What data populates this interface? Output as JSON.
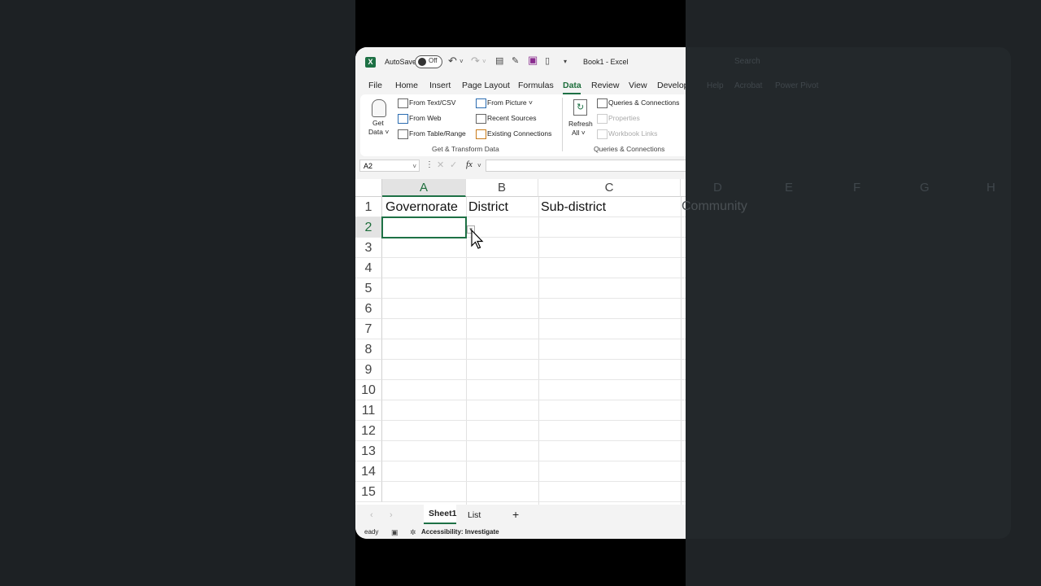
{
  "titlebar": {
    "autosave_label": "AutoSave",
    "autosave_state": "Off",
    "title": "Book1 - Excel"
  },
  "tabs": [
    "File",
    "Home",
    "Insert",
    "Page Layout",
    "Formulas",
    "Data",
    "Review",
    "View",
    "Develop"
  ],
  "active_tab": "Data",
  "ribbon": {
    "get_data": {
      "line1": "Get",
      "line2": "Data ˅"
    },
    "from_text_csv": "From Text/CSV",
    "from_web": "From Web",
    "from_table_range": "From Table/Range",
    "from_picture": "From Picture ˅",
    "recent_sources": "Recent Sources",
    "existing_connections": "Existing Connections",
    "group1_label": "Get & Transform Data",
    "refresh": {
      "line1": "Refresh",
      "line2": "All ˅"
    },
    "queries_connections": "Queries & Connections",
    "properties": "Properties",
    "workbook_links": "Workbook Links",
    "group2_label": "Queries & Connections"
  },
  "formula_bar": {
    "name_box": "A2",
    "fx": "fx",
    "value": ""
  },
  "grid": {
    "columns": [
      "A",
      "B",
      "C"
    ],
    "selected_column": "A",
    "rows": [
      "1",
      "2",
      "3",
      "4",
      "5",
      "6",
      "7",
      "8",
      "9",
      "10",
      "11",
      "12",
      "13",
      "14",
      "15"
    ],
    "selected_row": "2",
    "row1_values": [
      "Governorate",
      "District",
      "Sub-district"
    ],
    "active_cell": "A2"
  },
  "overlay": {
    "extra_columns": [
      "D",
      "E",
      "F",
      "G",
      "H"
    ],
    "overflow_header": "Community",
    "ribbon_tabs": [
      "Help",
      "Acrobat",
      "Power Pivot"
    ],
    "search_placeholder": "Search"
  },
  "sheets": {
    "tabs": [
      "Sheet1",
      "List"
    ],
    "active": "Sheet1",
    "add": "+"
  },
  "status": {
    "ready": "eady",
    "accessibility": "Accessibility: Investigate"
  },
  "colors": {
    "excel_green": "#1e7145",
    "dim_overlay": "#1f2326"
  }
}
